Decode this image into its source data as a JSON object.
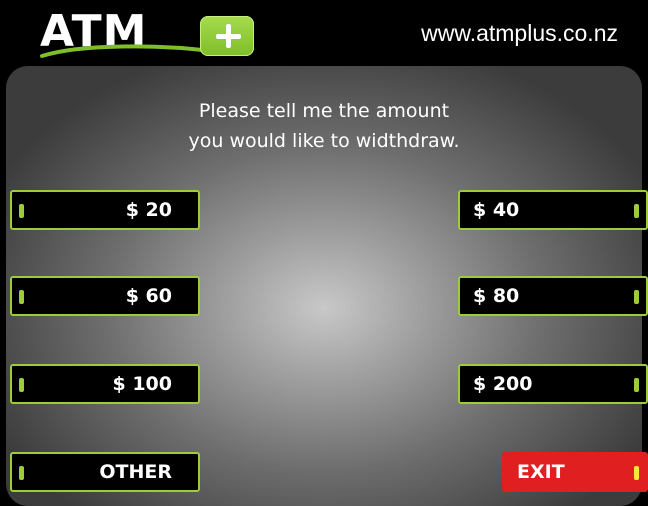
{
  "header": {
    "logo_text": "ATM",
    "url": "www.atmplus.co.nz"
  },
  "prompt": {
    "line1": "Please tell me the amount",
    "line2": "you would like to widthdraw."
  },
  "amounts": {
    "a20": "$ 20",
    "a40": "$ 40",
    "a60": "$ 60",
    "a80": "$ 80",
    "a100": "$ 100",
    "a200": "$ 200",
    "other": "OTHER",
    "exit": "EXIT"
  },
  "colors": {
    "accent": "#9ccc3a",
    "exit": "#e02020",
    "background": "#000000"
  }
}
